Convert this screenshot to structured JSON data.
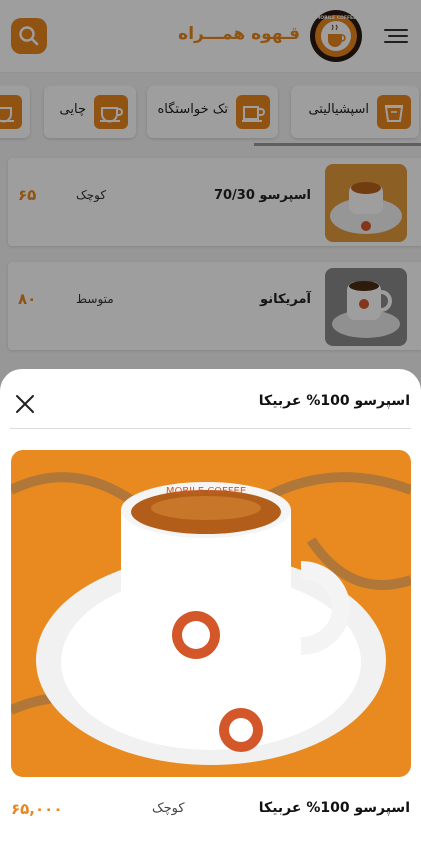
{
  "header": {
    "brand_title": "قـهوه همـــراه",
    "logo_text": "MOBILE COFFEE",
    "search_icon": "search-icon",
    "menu_icon": "menu-icon"
  },
  "categories": [
    {
      "label": "اسپشیالیتی",
      "icon": "cup-icon"
    },
    {
      "label": "تک خواستگاه",
      "icon": "mug-icon"
    },
    {
      "label": "چایی",
      "icon": "tea-cup-icon"
    },
    {
      "label": "",
      "icon": "cup-icon"
    }
  ],
  "products": [
    {
      "name": "اسپرسو 70/30",
      "size": "کوچک",
      "price": "۶۵"
    },
    {
      "name": "آمریکانو",
      "size": "متوسط",
      "price": "۸۰"
    }
  ],
  "sheet": {
    "title": "اسپرسو 100% عربیکا",
    "image_cup_text": "MOBILE COFFEE",
    "item_name": "اسپرسو 100% عربیکا",
    "item_size": "کوچک",
    "item_price": "۶۵,۰۰۰",
    "close_icon": "close-icon"
  },
  "colors": {
    "accent": "#e8871e",
    "overlay": "rgba(0,0,0,0.38)"
  }
}
